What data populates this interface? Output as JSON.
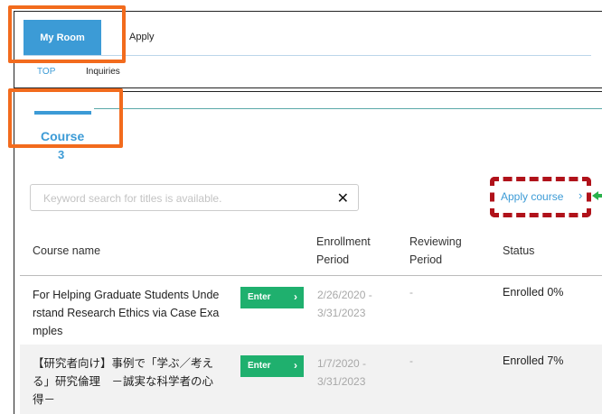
{
  "nav": {
    "tabs": [
      {
        "label": "My Room",
        "active": true
      },
      {
        "label": "Apply",
        "active": false
      }
    ],
    "subtabs": [
      {
        "label": "TOP",
        "active": true
      },
      {
        "label": "Inquiries",
        "active": false
      }
    ]
  },
  "course_tab": {
    "label": "Course",
    "count": "3"
  },
  "search": {
    "placeholder": "Keyword search for titles is available.",
    "value": ""
  },
  "apply_course": {
    "label": "Apply course"
  },
  "table": {
    "headers": {
      "course_name": "Course name",
      "enrollment_period": [
        "Enrollment",
        "Period"
      ],
      "reviewing_period": [
        "Reviewing",
        "Period"
      ],
      "status": "Status"
    },
    "rows": [
      {
        "course_name": [
          "For Helping Graduate Students Unde",
          "rstand Research Ethics via Case Exa",
          "mples"
        ],
        "enter_label": "Enter",
        "enrollment_period": [
          "2/26/2020 -",
          "3/31/2023"
        ],
        "reviewing_period": "-",
        "status": "Enrolled 0%"
      },
      {
        "course_name": [
          "【研究者向け】事例で「学ぶ／考え",
          "る」研究倫理　－誠実な科学者の心",
          "得－"
        ],
        "enter_label": "Enter",
        "enrollment_period": [
          "1/7/2020 -",
          "3/31/2023"
        ],
        "reviewing_period": "-",
        "status": "Enrolled 7%"
      }
    ]
  },
  "colors": {
    "accent_blue": "#3c9bd6",
    "enter_green": "#1fb06e",
    "highlight_orange": "#f26b1d",
    "highlight_dashed_red": "#b0121a"
  }
}
